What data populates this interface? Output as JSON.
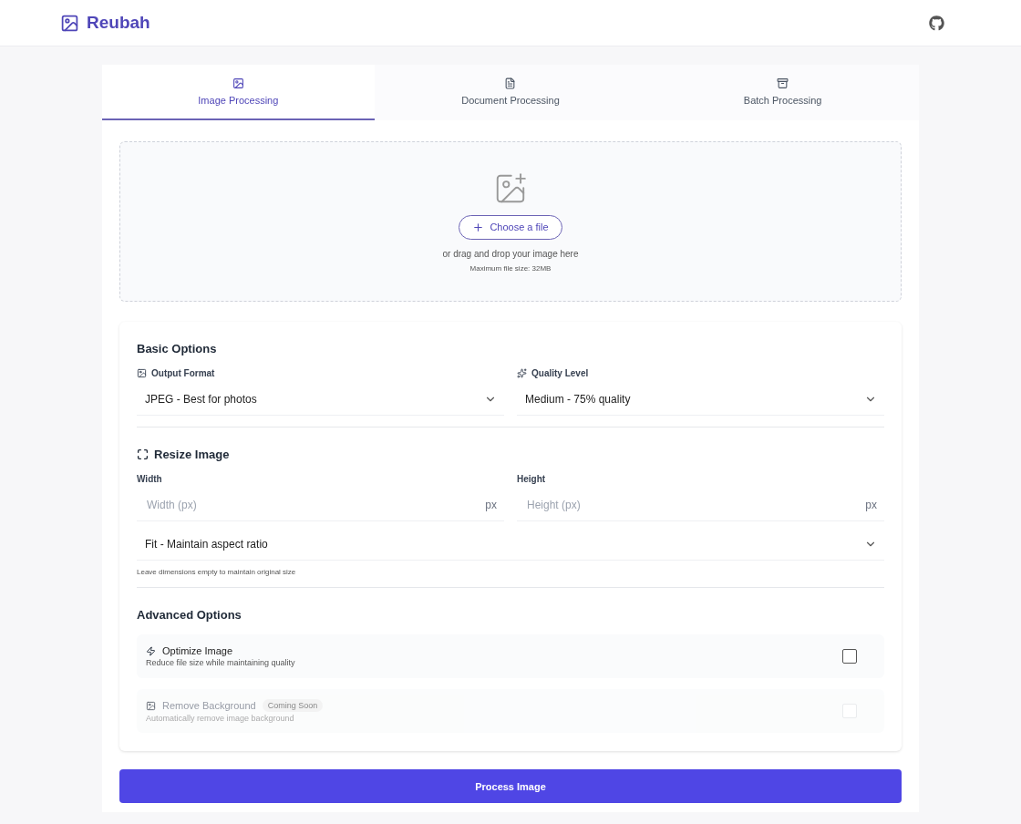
{
  "brand": "Reubah",
  "tabs": [
    {
      "label": "Image Processing",
      "kind": "image",
      "selected": true
    },
    {
      "label": "Document Processing",
      "kind": "document",
      "selected": false
    },
    {
      "label": "Batch Processing",
      "kind": "batch",
      "selected": false
    }
  ],
  "dropzone": {
    "button": "Choose a file",
    "hint": "or drag and drop your image here",
    "limit": "Maximum file size: 32MB"
  },
  "basic_options": {
    "title": "Basic Options",
    "fields": [
      {
        "label": "Output Format",
        "kind": "format",
        "value": "JPEG - Best for photos"
      },
      {
        "label": "Quality Level",
        "kind": "quality",
        "value": "Medium - 75% quality"
      }
    ]
  },
  "resize": {
    "title": "Resize Image",
    "inputs": [
      {
        "label": "Width",
        "placeholder": "Width (px)",
        "unit": "px"
      },
      {
        "label": "Height",
        "placeholder": "Height (px)",
        "unit": "px"
      }
    ],
    "mode": "Fit - Maintain aspect ratio",
    "note": "Leave dimensions empty to maintain original size"
  },
  "advanced_options": {
    "title": "Advanced Options",
    "items": [
      {
        "kind": "optimize",
        "title": "Optimize Image",
        "description": "Reduce file size while maintaining quality",
        "checked": false,
        "disabled": false
      },
      {
        "kind": "background",
        "title": "Remove Background",
        "badge": "Coming Soon",
        "description": "Automatically remove image background",
        "checked": false,
        "disabled": true
      }
    ]
  },
  "submit": "Process Image"
}
